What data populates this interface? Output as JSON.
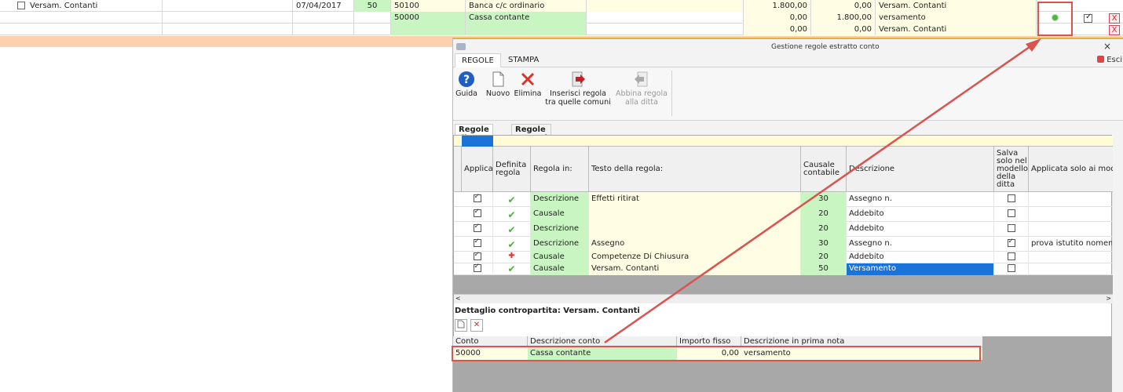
{
  "bg_rows": [
    {
      "desc": "Versam. Contanti",
      "date": "07/04/2017",
      "caus": "50",
      "conto": "50100",
      "conto_desc": "Banca c/c ordinario",
      "dare": "1.800,00",
      "avere": "0,00",
      "nota": "Versam. Contanti"
    },
    {
      "conto": "50000",
      "conto_desc": "Cassa contante",
      "dare": "0,00",
      "avere": "1.800,00",
      "nota": "versamento"
    },
    {
      "dare": "0,00",
      "avere": "0,00",
      "nota": "Versam. Contanti"
    }
  ],
  "row_delete_label": "X",
  "dialog": {
    "title": "Gestione regole estratto conto",
    "close": "×",
    "tabs": [
      "REGOLE",
      "STAMPA"
    ],
    "exit_label": "Esci",
    "toolbar": {
      "guida": "Guida",
      "nuovo": "Nuovo",
      "elimina": "Elimina",
      "inserisci_1": "Inserisci regola",
      "inserisci_2": "tra quelle comuni",
      "abbina_1": "Abbina regola",
      "abbina_2": "alla ditta"
    },
    "inner_tabs": [
      "Regole ditta",
      "Regole comuni"
    ],
    "columns": [
      "Applica",
      "Definita regola",
      "Regola in:",
      "Testo della regola:",
      "Causale contabile",
      "Descrizione",
      "Salva solo nel modello della ditta",
      "Applicata solo ai mod"
    ],
    "rows": [
      {
        "regola_in": "Descrizione",
        "testo": "Effetti ritirat",
        "causale": "30",
        "descrizione": "Assegno n.",
        "salva": false,
        "applicata": ""
      },
      {
        "regola_in": "Causale",
        "testo": "",
        "causale": "20",
        "descrizione": "Addebito",
        "salva": false,
        "applicata": ""
      },
      {
        "regola_in": "Descrizione",
        "testo": "",
        "causale": "20",
        "descrizione": "Addebito",
        "salva": false,
        "applicata": ""
      },
      {
        "regola_in": "Descrizione",
        "testo": "Assegno",
        "causale": "30",
        "descrizione": "Assegno n.",
        "salva": true,
        "applicata": "prova istutito nomem"
      },
      {
        "regola_in": "Causale",
        "testo": "Competenze Di Chiusura",
        "causale": "20",
        "descrizione": "Addebito",
        "salva": false,
        "applicata": ""
      },
      {
        "regola_in": "Causale",
        "testo": "Versam. Contanti",
        "causale": "50",
        "descrizione": "Versamento",
        "salva": false,
        "applicata": ""
      }
    ],
    "detail": {
      "title": "Dettaglio contropartita: Versam. Contanti",
      "columns": [
        "Conto",
        "Descrizione conto",
        "Importo fisso",
        "Descrizione in prima nota"
      ],
      "row": {
        "conto": "50000",
        "descrizione": "Cassa contante",
        "importo": "0,00",
        "nota": "versamento"
      }
    }
  },
  "colors": {
    "accent": "#1a73d9",
    "annotation": "#d9534f",
    "green_cell": "#c9f5c2",
    "yellow_cell": "#fffde3"
  }
}
